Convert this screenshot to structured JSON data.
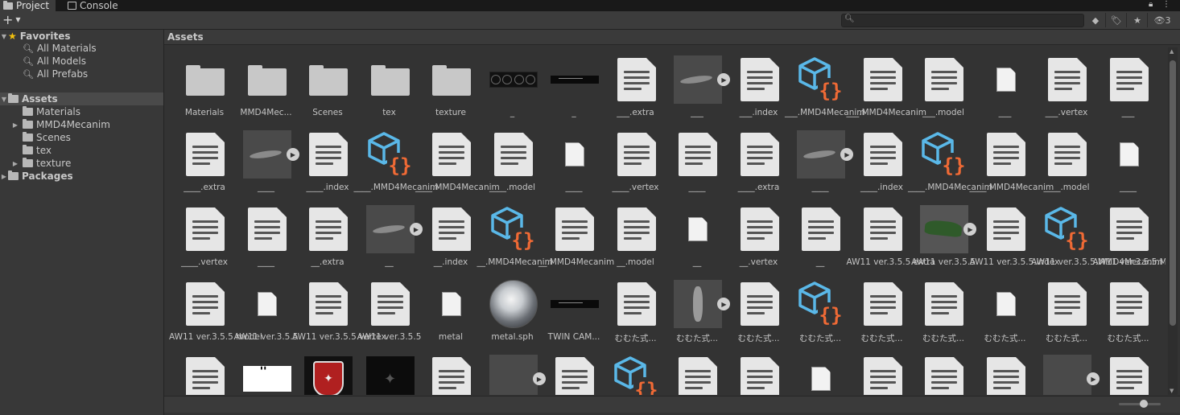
{
  "tabs": [
    {
      "label": "Project",
      "icon": "folder-icon",
      "active": true
    },
    {
      "label": "Console",
      "icon": "console-icon",
      "active": false
    }
  ],
  "toolbar": {
    "add_label": "+",
    "search_placeholder": "",
    "hidden_count": "3"
  },
  "sidebar": {
    "favorites": {
      "label": "Favorites",
      "items": [
        "All Materials",
        "All Models",
        "All Prefabs"
      ]
    },
    "assets": {
      "label": "Assets",
      "children": [
        "Materials",
        "MMD4Mecanim",
        "Scenes",
        "tex",
        "texture"
      ]
    },
    "packages": {
      "label": "Packages"
    }
  },
  "breadcrumb": "Assets",
  "grid": {
    "rows": [
      [
        {
          "kind": "folder",
          "label": "Materials"
        },
        {
          "kind": "folder",
          "label": "MMD4Mec..."
        },
        {
          "kind": "folder",
          "label": "Scenes"
        },
        {
          "kind": "folder",
          "label": "tex"
        },
        {
          "kind": "folder",
          "label": "texture"
        },
        {
          "kind": "tex-gauge",
          "label": "_"
        },
        {
          "kind": "tex-bar",
          "label": "_"
        },
        {
          "kind": "doc",
          "label": "___.extra"
        },
        {
          "kind": "mesh",
          "label": "___"
        },
        {
          "kind": "doc",
          "label": "___.index"
        },
        {
          "kind": "cube",
          "label": "___.MMD4Mecanim"
        },
        {
          "kind": "doc",
          "label": "___.MMD4Mecanim"
        },
        {
          "kind": "doc",
          "label": "___.model"
        },
        {
          "kind": "pdoc",
          "label": "___"
        },
        {
          "kind": "doc",
          "label": "___.vertex"
        },
        {
          "kind": "doc",
          "label": "___"
        }
      ],
      [
        {
          "kind": "doc",
          "label": "____.extra"
        },
        {
          "kind": "mesh",
          "label": "____"
        },
        {
          "kind": "doc",
          "label": "____.index"
        },
        {
          "kind": "cube",
          "label": "____.MMD4Mecanim"
        },
        {
          "kind": "doc",
          "label": "____.MMD4Mecanim"
        },
        {
          "kind": "doc",
          "label": "____.model"
        },
        {
          "kind": "pdoc",
          "label": "____"
        },
        {
          "kind": "doc",
          "label": "____.vertex"
        },
        {
          "kind": "doc",
          "label": "____"
        },
        {
          "kind": "doc",
          "label": "____.extra"
        },
        {
          "kind": "mesh",
          "label": "____"
        },
        {
          "kind": "doc",
          "label": "____.index"
        },
        {
          "kind": "cube",
          "label": "____.MMD4Mecanim"
        },
        {
          "kind": "doc",
          "label": "____.MMD4Mecanim"
        },
        {
          "kind": "doc",
          "label": "____.model"
        },
        {
          "kind": "pdoc",
          "label": "____"
        }
      ],
      [
        {
          "kind": "doc",
          "label": "____.vertex"
        },
        {
          "kind": "doc",
          "label": "____"
        },
        {
          "kind": "doc",
          "label": "__.extra"
        },
        {
          "kind": "mesh",
          "label": "__"
        },
        {
          "kind": "doc",
          "label": "__.index"
        },
        {
          "kind": "cube",
          "label": "__.MMD4Mecanim"
        },
        {
          "kind": "doc",
          "label": "__.MMD4Mecanim"
        },
        {
          "kind": "doc",
          "label": "__.model"
        },
        {
          "kind": "pdoc",
          "label": "__"
        },
        {
          "kind": "doc",
          "label": "__.vertex"
        },
        {
          "kind": "doc",
          "label": "__"
        },
        {
          "kind": "doc",
          "label": "AW11  ver.3.5.5.extra"
        },
        {
          "kind": "mesh-car",
          "label": "AW11  ver.3.5.5"
        },
        {
          "kind": "doc",
          "label": "AW11  ver.3.5.5.index"
        },
        {
          "kind": "cube",
          "label": "AW11  ver.3.5.5.MMD4Mecanim"
        },
        {
          "kind": "doc",
          "label": "AW11  ver.3.5.5.MMD4Mecanim"
        }
      ],
      [
        {
          "kind": "doc",
          "label": "AW11  ver.3.5.5.model"
        },
        {
          "kind": "pdoc",
          "label": "AW11  ver.3.5.5"
        },
        {
          "kind": "doc",
          "label": "AW11  ver.3.5.5.vertex"
        },
        {
          "kind": "doc",
          "label": "AW11  ver.3.5.5"
        },
        {
          "kind": "pdoc",
          "label": "metal"
        },
        {
          "kind": "tex-sphere",
          "label": "metal.sph"
        },
        {
          "kind": "tex-bar",
          "label": "TWIN CAM..."
        },
        {
          "kind": "doc",
          "label": "むむた式..."
        },
        {
          "kind": "mesh-figure",
          "label": "むむた式..."
        },
        {
          "kind": "doc",
          "label": "むむた式..."
        },
        {
          "kind": "cube",
          "label": "むむた式..."
        },
        {
          "kind": "doc",
          "label": "むむた式..."
        },
        {
          "kind": "doc",
          "label": "むむた式..."
        },
        {
          "kind": "pdoc",
          "label": "むむた式..."
        },
        {
          "kind": "doc",
          "label": "むむた式..."
        },
        {
          "kind": "doc",
          "label": "むむた式..."
        }
      ],
      [
        {
          "kind": "doc",
          "label": ""
        },
        {
          "kind": "tex-white",
          "label": ""
        },
        {
          "kind": "tex-emblem",
          "label": ""
        },
        {
          "kind": "tex-dark",
          "label": ""
        },
        {
          "kind": "doc",
          "label": ""
        },
        {
          "kind": "mesh-gray",
          "label": ""
        },
        {
          "kind": "doc",
          "label": ""
        },
        {
          "kind": "cube",
          "label": ""
        },
        {
          "kind": "doc",
          "label": ""
        },
        {
          "kind": "doc",
          "label": ""
        },
        {
          "kind": "pdoc",
          "label": ""
        },
        {
          "kind": "doc",
          "label": ""
        },
        {
          "kind": "doc",
          "label": ""
        },
        {
          "kind": "doc",
          "label": ""
        },
        {
          "kind": "mesh-gray",
          "label": ""
        },
        {
          "kind": "doc",
          "label": ""
        }
      ]
    ]
  },
  "colors": {
    "cube_blue": "#5ab8e8",
    "brace_orange": "#f06a35",
    "favorite_star": "#f4c20d"
  }
}
